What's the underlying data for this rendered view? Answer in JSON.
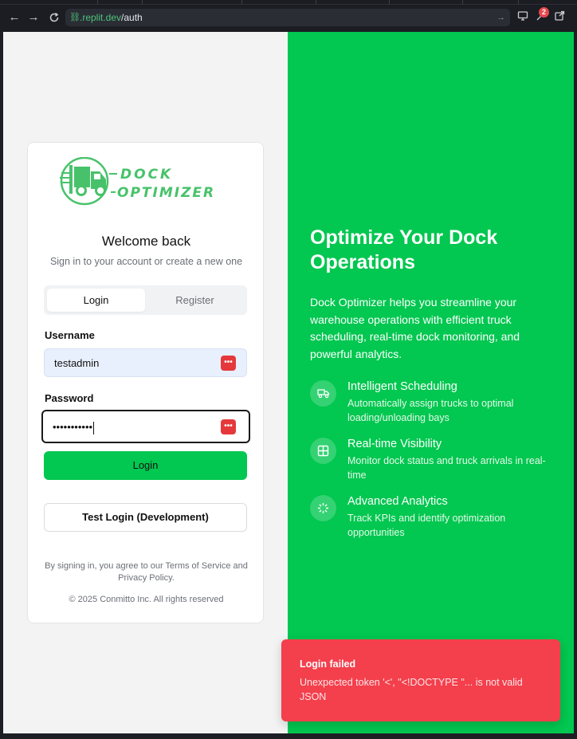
{
  "browser": {
    "url_domain": ".replit.dev",
    "url_path": "/auth",
    "back_icon": "arrow-left-icon",
    "forward_icon": "arrow-right-icon",
    "reload_icon": "reload-icon",
    "badge_count": "2"
  },
  "auth_card": {
    "logo_line1": "DOCK",
    "logo_line2": "OPTIMIZER",
    "welcome": "Welcome back",
    "subtitle": "Sign in to your account or create a new one",
    "tabs": [
      {
        "label": "Login",
        "active": true
      },
      {
        "label": "Register",
        "active": false
      }
    ],
    "username_label": "Username",
    "username_value": "testadmin",
    "password_label": "Password",
    "password_value": "•••••••••••",
    "login_button": "Login",
    "test_login_button": "Test Login (Development)",
    "terms_text": "By signing in, you agree to our Terms of Service and Privacy Policy.",
    "copyright": "© 2025 Conmitto Inc. All rights reserved"
  },
  "hero": {
    "title": "Optimize Your Dock Operations",
    "description": "Dock Optimizer helps you streamline your warehouse operations with efficient truck scheduling, real-time dock monitoring, and powerful analytics.",
    "features": [
      {
        "icon": "truck-icon",
        "title": "Intelligent Scheduling",
        "description": "Automatically assign trucks to optimal loading/unloading bays"
      },
      {
        "icon": "grid-icon",
        "title": "Real-time Visibility",
        "description": "Monitor dock status and truck arrivals in real-time"
      },
      {
        "icon": "loader-icon",
        "title": "Advanced Analytics",
        "description": "Track KPIs and identify optimization opportunities"
      }
    ]
  },
  "toast": {
    "title": "Login failed",
    "message": "Unexpected token '<', \"<!DOCTYPE \"... is not valid JSON"
  },
  "colors": {
    "brand_green": "#02c750",
    "toast_red": "#f43f4c"
  }
}
